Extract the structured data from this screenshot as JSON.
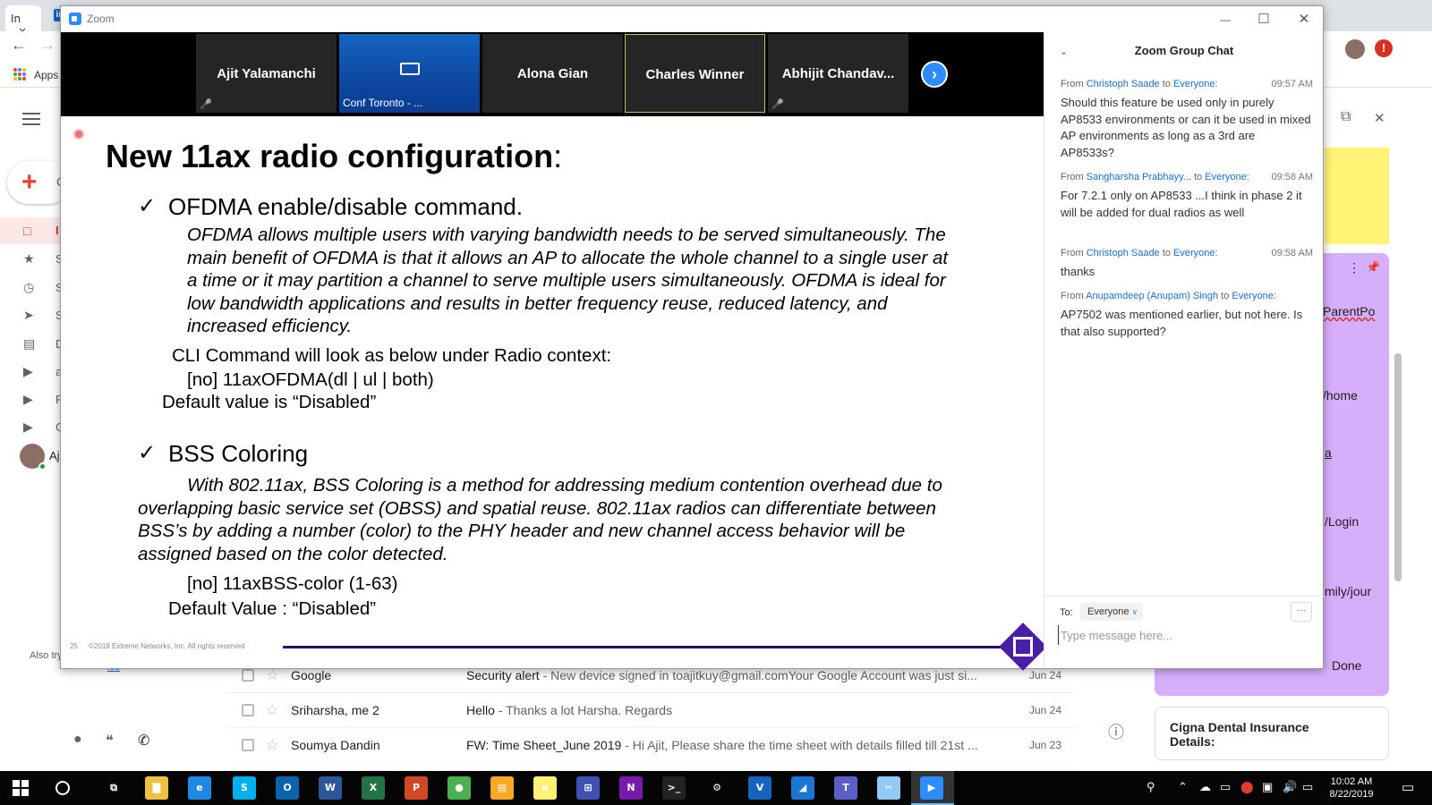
{
  "browser": {
    "tab1_label": "In",
    "tab1_close": "×",
    "tab2_icon": "in",
    "apps_label": "Apps",
    "back": "←",
    "forward": "→"
  },
  "gmail": {
    "compose_label": "C",
    "also_try": "Also try",
    "sidebar_partials": [
      "I",
      "S",
      "S",
      "S",
      "D",
      "a",
      "F",
      "C",
      "Aj"
    ],
    "sidebar_icons": [
      "□",
      "★",
      "◷",
      "➤",
      "▤",
      "▶",
      "▶",
      "▶"
    ],
    "bottom_icons": [
      "●",
      "❝",
      "✆"
    ],
    "link_fragment": "ios",
    "mail_rows": [
      {
        "sender": "Google",
        "subject": "Security alert",
        "snippet": " - New device signed in toajitkuy@gmail.comYour Google Account was just si...",
        "date": "Jun 24"
      },
      {
        "sender": "Sriharsha, me 2",
        "subject": "Hello",
        "snippet": " - Thanks a lot Harsha. Regards",
        "date": "Jun 24"
      },
      {
        "sender": "Soumya Dandin",
        "subject": "FW: Time Sheet_June 2019",
        "snippet": " - Hi Ajit, Please share the time sheet with details filled till 21st ...",
        "date": "Jun 23"
      }
    ],
    "info_icon": "ⓘ"
  },
  "keep": {
    "note_fragments": [
      "ParentPo",
      "/home",
      "/Login",
      "mily/jour"
    ],
    "done_label": "Done",
    "cigna_title": "Cigna Dental Insurance Details:",
    "popout": "⧉",
    "close": "✕"
  },
  "zoom": {
    "window_title": "Zoom",
    "controls": {
      "minimize": "—",
      "maximize": "☐",
      "close": "✕"
    },
    "participants": [
      {
        "name": "Ajit Yalamanchi",
        "muted": true
      },
      {
        "name": "",
        "caption": "Conf Toronto - ...",
        "video_off": true
      },
      {
        "name": "Alona Gian",
        "muted": false
      },
      {
        "name": "Charles Winner",
        "muted": false,
        "active": true
      },
      {
        "name": "Abhijit  Chandav...",
        "muted": true
      }
    ],
    "next_arrow": "›",
    "mute_icon": "🎤",
    "slide": {
      "title": "New 11ax radio configuration",
      "title_colon": ":",
      "check": "✓",
      "bullet1": "OFDMA enable/disable command.",
      "para1": [
        "OFDMA allows multiple users with varying bandwidth needs to be served simultaneously. The",
        "main benefit of OFDMA is that it allows an AP to allocate the whole channel to a single user at",
        "a time or it may partition a channel to serve multiple users simultaneously. OFDMA is ideal for",
        "low bandwidth applications and results in better frequency reuse, reduced latency, and",
        "increased efficiency."
      ],
      "cli_intro": "CLI Command will look as below under Radio context:",
      "cli_cmd1": "[no] 11axOFDMA(dl | ul | both)",
      "default1": "Default value is “Disabled”",
      "bullet2": "BSS Coloring",
      "para2": [
        "With 802.11ax, BSS Coloring is a method for addressing medium contention overhead due to",
        "overlapping basic service set (OBSS) and spatial reuse. 802.11ax radios can differentiate between",
        "BSS’s by adding a number (color) to the PHY header and new channel access behavior will be",
        "assigned based on the color detected."
      ],
      "cli_cmd2": "[no] 11axBSS-color (1-63)",
      "default2": "Default Value : “Disabled”",
      "footer_page": "25",
      "footer_copy": "©2018 Extreme Networks, Inc.  All rights reserved"
    },
    "chat": {
      "title": "Zoom Group Chat",
      "messages": [
        {
          "from_label": "From ",
          "from": "Christoph Saade",
          "to_label": " to ",
          "to": "Everyone:",
          "time": "09:57 AM",
          "text": "Should this feature be used only in purely AP8533 environments or can it be used in mixed AP environments as long as a 3rd are AP8533s?"
        },
        {
          "from_label": "From ",
          "from": "Sangharsha Prabhayy...",
          "to_label": "  to ",
          "to": "Everyone:",
          "time": "09:58 AM",
          "text": "For 7.2.1 only on AP8533 ...I think in phase 2 it will be added for dual radios as well"
        },
        {
          "from_label": "From ",
          "from": "Christoph Saade",
          "to_label": " to ",
          "to": "Everyone:",
          "time": "09:58 AM",
          "text": "thanks"
        },
        {
          "from_label": "From ",
          "from": "Anupamdeep (Anupam) Singh",
          "to_label": " to ",
          "to": "Everyone:",
          "time": "",
          "text": "AP7502 was mentioned earlier, but not here. Is that also supported?"
        }
      ],
      "to_label": "To:",
      "to_value": "Everyone",
      "more": "···",
      "input_placeholder": "Type message here..."
    }
  },
  "taskbar": {
    "apps": [
      {
        "name": "task-view",
        "label": "⧉",
        "color": "transparent"
      },
      {
        "name": "file-explorer",
        "label": "▇",
        "color": "#f0c040"
      },
      {
        "name": "internet-explorer",
        "label": "e",
        "color": "#1e88e5"
      },
      {
        "name": "skype",
        "label": "S",
        "color": "#00aff0"
      },
      {
        "name": "outlook",
        "label": "O",
        "color": "#0a64ad"
      },
      {
        "name": "word",
        "label": "W",
        "color": "#2b579a"
      },
      {
        "name": "excel",
        "label": "X",
        "color": "#217346"
      },
      {
        "name": "powerpoint",
        "label": "P",
        "color": "#d24726"
      },
      {
        "name": "chrome",
        "label": "●",
        "color": "#4caf50"
      },
      {
        "name": "file-manager",
        "label": "▤",
        "color": "#f9a825"
      },
      {
        "name": "sticky-notes",
        "label": "▪",
        "color": "#fff176"
      },
      {
        "name": "network-app",
        "label": "⊞",
        "color": "#3f51b5"
      },
      {
        "name": "onenote",
        "label": "N",
        "color": "#7719aa"
      },
      {
        "name": "terminal",
        "label": ">_",
        "color": "#222"
      },
      {
        "name": "settings",
        "label": "⚙",
        "color": "transparent"
      },
      {
        "name": "vscode-app",
        "label": "V",
        "color": "#1565c0"
      },
      {
        "name": "fin-app",
        "label": "◢",
        "color": "#1976d2"
      },
      {
        "name": "teams",
        "label": "T",
        "color": "#5b5fc7"
      },
      {
        "name": "snip-tool",
        "label": "✂",
        "color": "#90caf9"
      },
      {
        "name": "zoom",
        "label": "▶",
        "color": "#2d8cff"
      }
    ],
    "time": "10:02 AM",
    "date": "8/22/2019",
    "tray_icons": [
      "⚲",
      "⌃",
      "☁",
      "▭",
      "⬤",
      "▣",
      "🔊",
      "▭"
    ]
  }
}
